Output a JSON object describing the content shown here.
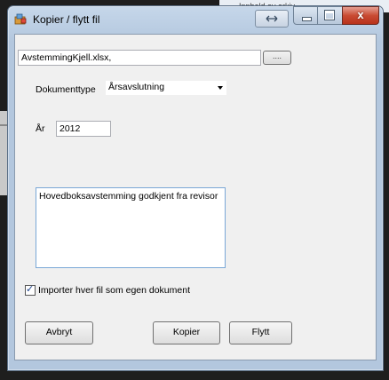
{
  "background": {
    "right_fragment_text": "Innhold av arkiv"
  },
  "window": {
    "title": "Kopier / flytt fil",
    "close_glyph": "x"
  },
  "form": {
    "file_path": "AvstemmingKjell.xlsx,",
    "browse_label": "....",
    "doc_type_label": "Dokumenttype",
    "doc_type_value": "Årsavslutning",
    "year_label": "År",
    "year_value": "2012",
    "comment_value": "Hovedboksavstemming godkjent fra revisor",
    "import_checkbox_label": "Importer hver fil som egen dokument",
    "import_checked": true
  },
  "buttons": {
    "cancel": "Avbryt",
    "copy": "Kopier",
    "move": "Flytt"
  },
  "colors": {
    "titlebar": "#b3c7de",
    "close_button": "#c94b33",
    "client_bg": "#f0f0f0"
  },
  "icons": [
    "app-icon",
    "restore-icon",
    "minimize-icon",
    "maximize-icon",
    "close-icon",
    "checkmark-icon"
  ]
}
